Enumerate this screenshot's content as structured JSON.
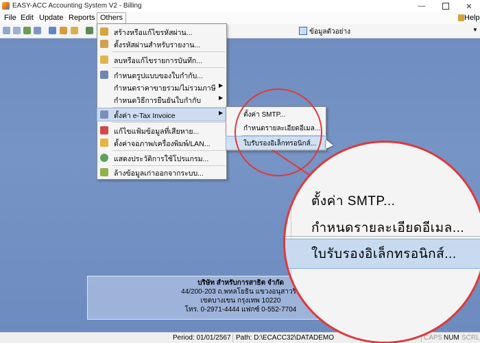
{
  "window": {
    "title": "EASY-ACC Accounting System V2 - Billing"
  },
  "menubar": {
    "items": [
      {
        "label": "File"
      },
      {
        "label": "Edit"
      },
      {
        "label": "Update"
      },
      {
        "label": "Reports"
      },
      {
        "label": "Others"
      }
    ],
    "help_label": "Help"
  },
  "toolbar": {
    "database_label": "ข้อมูลตัวอย่าง"
  },
  "others_menu": {
    "items": [
      {
        "label": "สร้างหรือแก้ไขรหัสผ่าน..."
      },
      {
        "label": "ตั้งรหัสผ่านสำหรับรายงาน..."
      },
      {
        "label": "ลบหรือแก้ไขรายการบันทึก..."
      },
      {
        "label": "กำหนดรูปแบบของใบกำกับ..."
      },
      {
        "label": "กำหนดราคาขายรวม/ไม่รวมภาษี"
      },
      {
        "label": "กำหนดวิธีการยืนยันใบกำกับ"
      },
      {
        "label": "ตั้งค่า e-Tax Invoice"
      },
      {
        "label": "แก้ไขแฟ้มข้อมูลที่เสียหาย..."
      },
      {
        "label": "ตั้งค่าจอภาพ/เครื่องพิมพ์/LAN..."
      },
      {
        "label": "แสดงประวัติการใช้โปรแกรม..."
      },
      {
        "label": "ล้างข้อมูลเก่าออกจากระบบ..."
      }
    ]
  },
  "etax_submenu": {
    "items": [
      {
        "label": "ตั้งค่า SMTP..."
      },
      {
        "label": "กำหนดรายละเอียดอีเมล..."
      },
      {
        "label": "ใบรับรองอิเล็กทรอนิกส์..."
      }
    ]
  },
  "company": {
    "name": "บริษัท สำหรับการสาธิต จำกัด",
    "address1": "44/200-203 ถ.พหลโยธิน แขวงอนุสาวรีย์",
    "address2": "เขตบางเขน กรุงเทพ 10220",
    "phone": "โทร. 0-2971-4444 แฟกซ์ 0-552-7704"
  },
  "statusbar": {
    "period": "Period: 01/01/2567",
    "path": "Path: D:\\ECACC32\\DATADEMO",
    "caps": "CAPS",
    "num": "NUM",
    "scrl": "SCRL"
  }
}
